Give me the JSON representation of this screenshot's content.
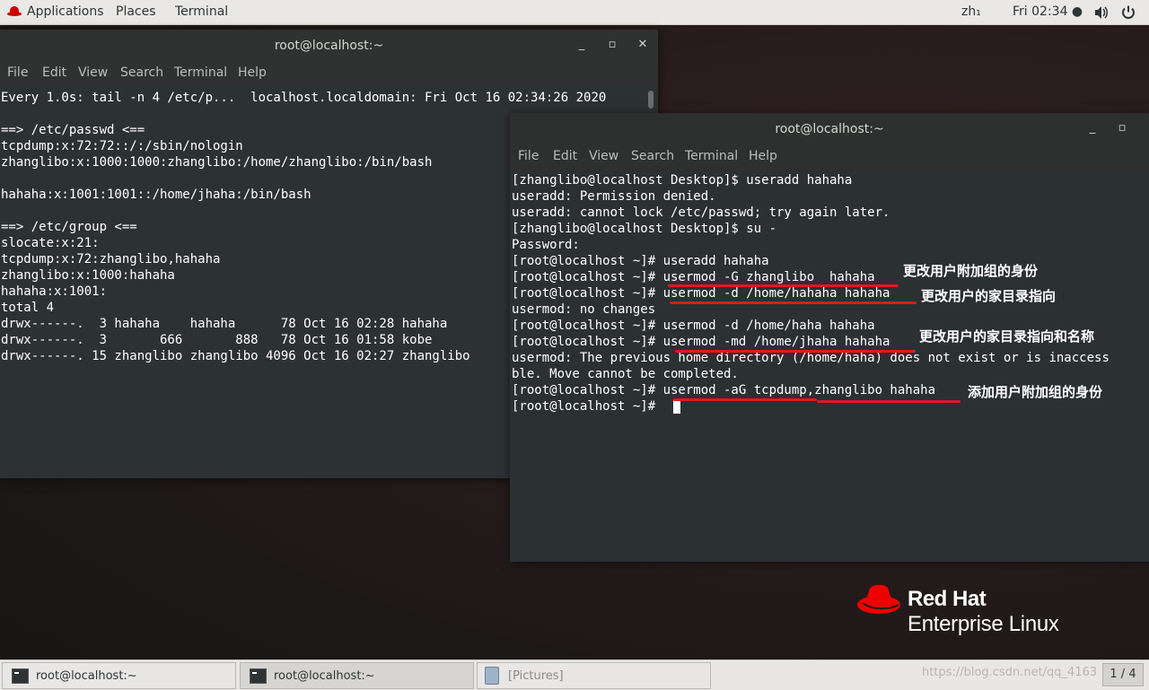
{
  "topbar": {
    "applications": "Applications",
    "places": "Places",
    "terminal": "Terminal",
    "input_method": "zh₁",
    "clock": "Fri 02:34 ●",
    "volume_icon": "speaker-icon",
    "power_icon": "power-icon"
  },
  "win1": {
    "title": "root@localhost:~",
    "menu": [
      "File",
      "Edit",
      "View",
      "Search",
      "Terminal",
      "Help"
    ],
    "lines": [
      "Every 1.0s: tail -n 4 /etc/p...  localhost.localdomain: Fri Oct 16 02:34:26 2020",
      "",
      "==> /etc/passwd <==",
      "tcpdump:x:72:72::/:/sbin/nologin",
      "zhanglibo:x:1000:1000:zhanglibo:/home/zhanglibo:/bin/bash",
      "",
      "hahaha:x:1001:1001::/home/jhaha:/bin/bash",
      "",
      "==> /etc/group <==",
      "slocate:x:21:",
      "tcpdump:x:72:zhanglibo,hahaha",
      "zhanglibo:x:1000:hahaha",
      "hahaha:x:1001:",
      "total 4",
      "drwx------.  3 hahaha    hahaha      78 Oct 16 02:28 hahaha",
      "drwx------.  3       666       888   78 Oct 16 01:58 kobe",
      "drwx------. 15 zhanglibo zhanglibo 4096 Oct 16 02:27 zhanglibo"
    ]
  },
  "win2": {
    "title": "root@localhost:~",
    "menu": [
      "File",
      "Edit",
      "View",
      "Search",
      "Terminal",
      "Help"
    ],
    "lines": [
      "[zhanglibo@localhost Desktop]$ useradd hahaha",
      "useradd: Permission denied.",
      "useradd: cannot lock /etc/passwd; try again later.",
      "[zhanglibo@localhost Desktop]$ su -",
      "Password:",
      "[root@localhost ~]# useradd hahaha",
      "[root@localhost ~]# usermod -G zhanglibo  hahaha",
      "[root@localhost ~]# usermod -d /home/hahaha hahaha",
      "usermod: no changes",
      "[root@localhost ~]# usermod -d /home/haha hahaha",
      "[root@localhost ~]# usermod -md /home/jhaha hahaha",
      "usermod: The previous home directory (/home/haha) does not exist or is inaccess",
      "ble. Move cannot be completed.",
      "[root@localhost ~]# usermod -aG tcpdump,zhanglibo hahaha",
      "[root@localhost ~]# "
    ],
    "annotations": [
      "更改用户附加组的身份",
      "更改用户的家目录指向",
      "更改用户的家目录指向和名称",
      "添加用户附加组的身份"
    ]
  },
  "logo": {
    "line1": "Red Hat",
    "line2": "Enterprise Linux"
  },
  "taskbar": {
    "tasks": [
      "root@localhost:~",
      "root@localhost:~",
      "[Pictures]"
    ],
    "watermark": "https://blog.csdn.net/qq_4163",
    "pager": "1 / 4"
  }
}
